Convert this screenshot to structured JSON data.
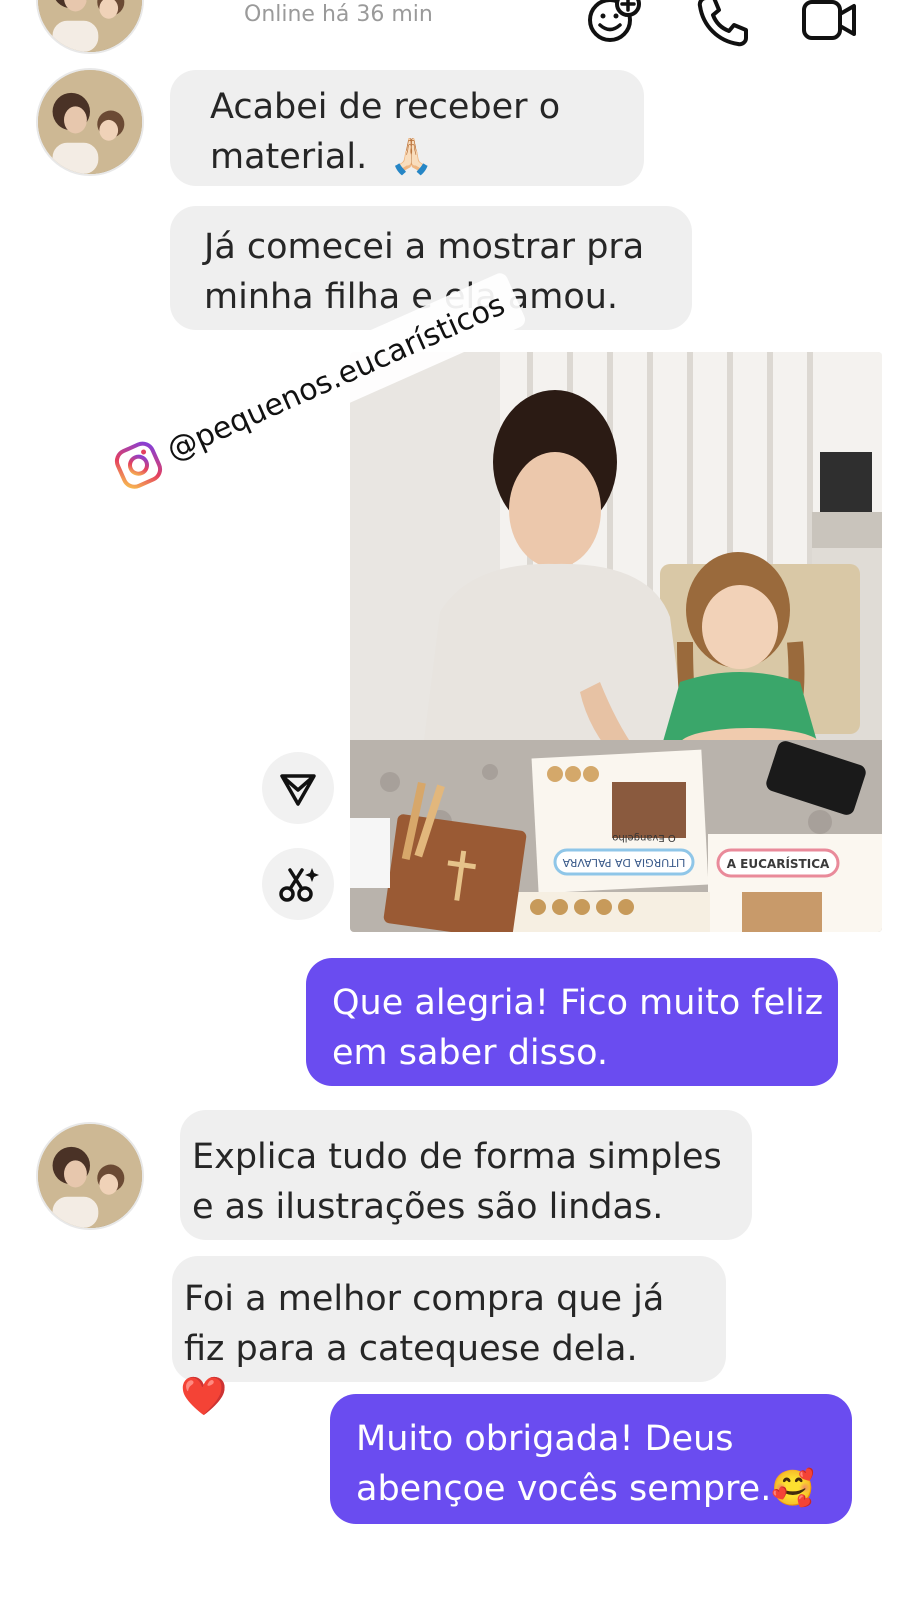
{
  "header": {
    "status": "Online há 36 min",
    "icons": [
      "effects-icon",
      "phone-icon",
      "video-icon"
    ]
  },
  "messages": {
    "in1": {
      "line1": "Acabei de receber o",
      "line2": "material.",
      "emoji": "🙏🏻"
    },
    "in2": {
      "line1": "Já comecei a mostrar pra",
      "line2": "minha filha e ela amou."
    },
    "photo_watermark": "@pequenos.eucarísticos",
    "photo_text": {
      "liturgia": "LITURGIA DA PALAVRA",
      "eucaristica": "A EUCARÍSTICA",
      "evangelho": "O Evangelho"
    },
    "out1": {
      "line1": "Que alegria! Fico muito feliz",
      "line2": "em saber disso."
    },
    "in3": {
      "line1": "Explica tudo de forma simples",
      "line2": "e as ilustrações são lindas."
    },
    "in4": {
      "line1": "Foi a melhor compra que já",
      "line2": "fiz para a catequese dela.",
      "reaction": "❤️"
    },
    "out2": {
      "line1": "Muito obrigada! Deus",
      "line2": "abençoe vocês sempre.",
      "emoji": "🥰"
    }
  },
  "colors": {
    "outgoing_bubble": "#6a4cf0",
    "incoming_bubble": "#efefef",
    "status_text": "#9a9a9a"
  }
}
